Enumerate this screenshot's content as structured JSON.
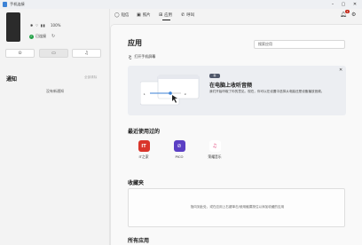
{
  "window": {
    "title": "手机连接"
  },
  "device": {
    "signal_icons": "✱ ⌔ ▮▮",
    "battery": "100%",
    "status": "已连接"
  },
  "quick_actions": [
    "⊙",
    "▭",
    "♫"
  ],
  "notifications": {
    "title": "通知",
    "clear_all": "全部清除",
    "empty": "没有新通知"
  },
  "nav": {
    "tabs": [
      {
        "icon": "◯",
        "label": "短信"
      },
      {
        "icon": "▣",
        "label": "照片"
      },
      {
        "icon": "⊞",
        "label": "应用"
      },
      {
        "icon": "✆",
        "label": "呼叫"
      }
    ],
    "badge": "1"
  },
  "apps_page": {
    "title": "应用",
    "search_placeholder": "搜索应用",
    "open_screen": "打开手机屏幕"
  },
  "banner": {
    "badge": "新",
    "title": "在电脑上收听音频",
    "text": "我们开始听取了你的意见。现在，你可以在设置中选择从电脑还是设备播放音频。"
  },
  "recent": {
    "title": "最近使用过的",
    "apps": [
      {
        "label": "IT之家",
        "color": "#d9352b",
        "icon": "IT"
      },
      {
        "label": "PICO",
        "color": "#5b3fc4",
        "icon": "⊘"
      },
      {
        "label": "荣耀音乐",
        "color": "#ffffff",
        "icon": "♫"
      }
    ]
  },
  "favorites": {
    "title": "收藏夹",
    "hint": "指向到此处，或在应用上右键单击/使用触摸按住以添加收藏的应用"
  },
  "all_apps": {
    "title": "所有应用"
  }
}
